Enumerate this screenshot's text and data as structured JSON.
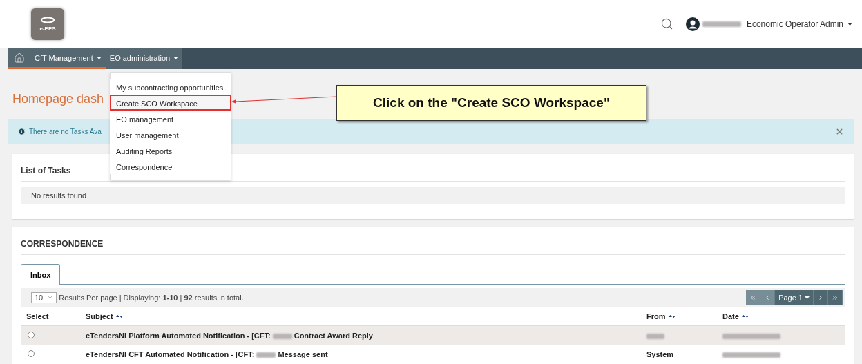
{
  "header": {
    "logo_text": "e-PPS",
    "user_role": "Economic Operator Admin"
  },
  "nav": {
    "items": [
      {
        "label": "CfT Management",
        "selected": true
      },
      {
        "label": "EO administration",
        "selected": false
      }
    ]
  },
  "dropdown": {
    "items": [
      {
        "label": "My subcontracting opportunities",
        "highlighted": false
      },
      {
        "label": "Create SCO Workspace",
        "highlighted": true
      },
      {
        "label": "EO management",
        "highlighted": false
      },
      {
        "label": "User management",
        "highlighted": false
      },
      {
        "label": "Auditing Reports",
        "highlighted": false
      },
      {
        "label": "Correspondence",
        "highlighted": false
      }
    ]
  },
  "annotation": {
    "text": "Click on the \"Create SCO Workspace\""
  },
  "page_title": "Homepage dash",
  "alert": {
    "text": "There are no Tasks Ava"
  },
  "tasks": {
    "title": "List of Tasks",
    "empty_text": "No results found"
  },
  "correspondence": {
    "title": "CORRESPONDENCE",
    "tabs": [
      {
        "label": "Inbox",
        "selected": true
      }
    ],
    "per_page": "10",
    "summary": "Results Per page | Displaying: **1-10** | **92** results in total.",
    "pager": {
      "page": "Page 1"
    },
    "columns": [
      "Select",
      "Subject",
      "From",
      "Date"
    ],
    "rows": [
      {
        "selected": false,
        "subject_start": "eTendersNI Platform Automated Notification - [CFT:",
        "subject_end": "Contract Award Reply"
      },
      {
        "selected": false,
        "subject_start": "eTendersNI CFT Automated Notification - [CFT:",
        "subject_end": "Message sent",
        "from": "System"
      }
    ]
  }
}
